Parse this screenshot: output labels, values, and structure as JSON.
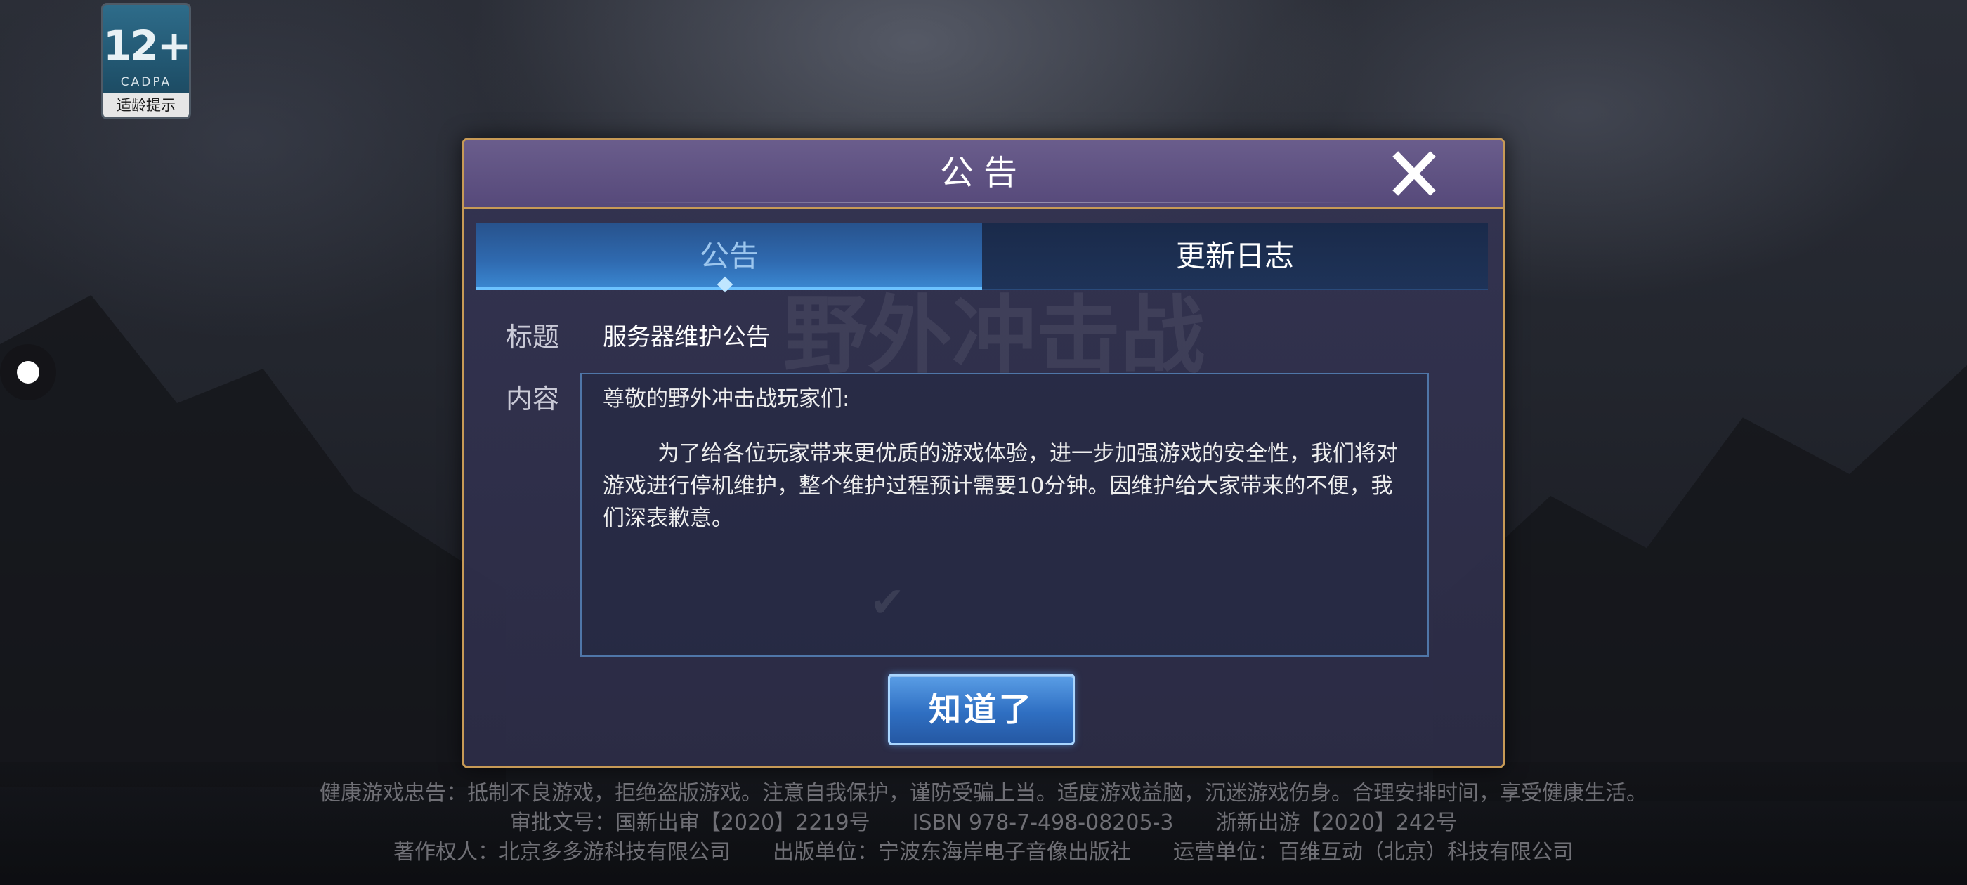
{
  "age_badge": {
    "rating": "12+",
    "org": "CADPA",
    "tip": "适龄提示"
  },
  "dialog": {
    "title": "公告",
    "watermark": "野外冲击战",
    "tabs": [
      {
        "label": "公告",
        "active": true
      },
      {
        "label": "更新日志",
        "active": false
      }
    ],
    "fields": {
      "title_label": "标题",
      "title_value": "服务器维护公告",
      "content_label": "内容"
    },
    "content": {
      "greeting": "尊敬的野外冲击战玩家们:",
      "body": "为了给各位玩家带来更优质的游戏体验，进一步加强游戏的安全性，我们将对游戏进行停机维护，整个维护过程预计需要10分钟。因维护给大家带来的不便，我们深表歉意。"
    },
    "confirm_label": "知道了"
  },
  "footer": {
    "warning": "健康游戏忠告：抵制不良游戏，拒绝盗版游戏。注意自我保护，谨防受骗上当。适度游戏益脑，沉迷游戏伤身。合理安排时间，享受健康生活。",
    "approval": "审批文号：国新出审【2020】2219号　　ISBN 978-7-498-08205-3　　浙新出游【2020】242号",
    "copyright": "著作权人：北京多多游科技有限公司　　出版单位：宁波东海岸电子音像出版社　　运营单位：百维互动（北京）科技有限公司"
  },
  "colors": {
    "dialog_border": "#c79a56",
    "header_bg": "#5f5284",
    "active_tab": "#2f6ab0",
    "confirm_button": "#2f6fc2"
  },
  "icons": {
    "close": "close-x-icon"
  }
}
